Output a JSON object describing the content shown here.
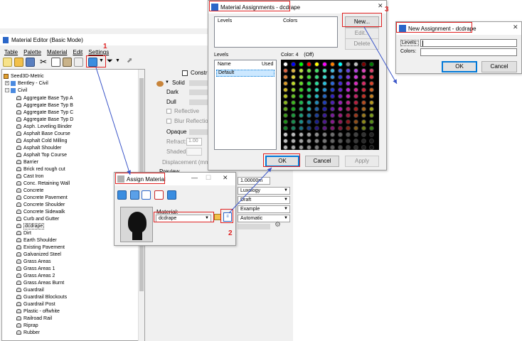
{
  "material_editor": {
    "title": "Material Editor (Basic Mode)",
    "menu": [
      "Table",
      "Palette",
      "Material",
      "Edit",
      "Settings"
    ],
    "tree_root": "Seed3D-Metric",
    "tree_bentley": "Bentley - Civil",
    "tree_civil": "Civil",
    "tree_items": [
      "Aggregate Base Typ A",
      "Aggregate Base Typ B",
      "Aggregate Base Typ C",
      "Aggregate Base Typ D",
      "Asph. Leveling Binder",
      "Asphalt Base Course",
      "Asphalt Cold Milling",
      "Asphalt Shoulder",
      "Asphalt Top Course",
      "Barrier",
      "Brick red rough cut",
      "Cast Iron",
      "Conc. Retaining Wall",
      "Concrete",
      "Concrete Pavement",
      "Concrete Shoulder",
      "Concrete Sidewalk",
      "Curb and Gutter",
      "dcdrape",
      "Dirt",
      "Earth Shoulder",
      "Existing Pavement",
      "Galvanized Steel",
      "Grass Areas",
      "Grass Areas 1",
      "Grass Areas 2",
      "Grass Areas Burnt",
      "Guardrail",
      "Guardrail Blockouts",
      "Guardrail Post",
      "Plastic - offwhite",
      "Railroad Rail",
      "Riprap",
      "Rubber"
    ],
    "selected_item": "dcdrape",
    "props": {
      "constrain": "Constrain",
      "solid": "Solid",
      "dark": "Dark",
      "dull": "Dull",
      "reflective": "Reflective",
      "blur_reflections": "Blur Reflections",
      "opaque": "Opaque",
      "refract_label": "Refract:",
      "refract_value": "1.00",
      "shaded": "Shaded:",
      "displacement": "Displacement (mm):",
      "preview": "Preview",
      "size_value": "1.00000m",
      "dd_luxology": "Luxology",
      "dd_draft": "Draft",
      "dd_example": "Example",
      "dd_automatic": "Automatic"
    }
  },
  "assign_material": {
    "title": "Assign Material",
    "material_label": "Material:",
    "material_value": "dcdrape"
  },
  "material_assignments": {
    "title": "Material Assignments - dcdrape",
    "col_levels": "Levels",
    "col_colors": "Colors",
    "btn_new": "New...",
    "btn_edit": "Edit...",
    "btn_delete": "Delete",
    "levels_label": "Levels",
    "levels_col_name": "Name",
    "levels_col_used": "Used",
    "levels_default": "Default",
    "color_label": "Color: 4    (Off)",
    "btn_ok": "OK",
    "btn_cancel": "Cancel",
    "btn_apply": "Apply"
  },
  "new_assignment": {
    "title": "New Assignment - dcdrape",
    "levels_label": "Levels:",
    "colors_label": "Colors:",
    "btn_ok": "OK",
    "btn_cancel": "Cancel"
  },
  "annotations": {
    "step1": "1",
    "step2": "2",
    "step3": "3"
  },
  "colors": {
    "annotation": "#e02020",
    "arrow": "#3a55c8",
    "selection": "#cce8ff"
  }
}
